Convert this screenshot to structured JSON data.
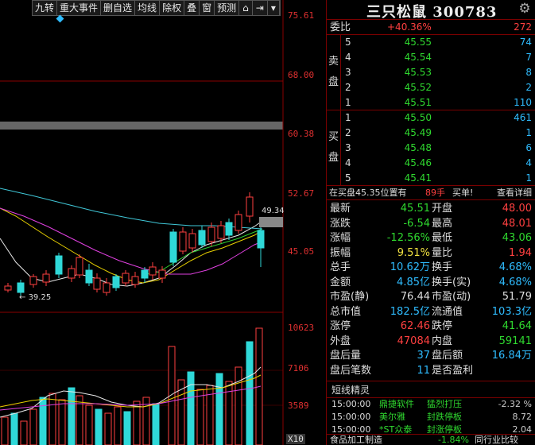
{
  "toolbar": {
    "items": [
      "九转",
      "重大事件",
      "删自选",
      "均线",
      "除权",
      "叠",
      "窗",
      "预测"
    ],
    "lock_icon": "lock-icon",
    "pin_icon": "pin-icon",
    "dropdown_icon": "triangle-down-icon"
  },
  "axis": {
    "price_labels": [
      "75.61",
      "68.00",
      "60.38",
      "52.67",
      "45.05"
    ],
    "volume_labels": [
      "10623",
      "7106",
      "3589"
    ],
    "volume_unit": "X10",
    "current_price_tag": "49.34",
    "low_marker": "39.25"
  },
  "stock": {
    "title": "三只松鼠 300783"
  },
  "weibi": {
    "label": "委比",
    "pct": "+40.36%",
    "diff": "272"
  },
  "sell": {
    "side_label": [
      "卖",
      "盘"
    ],
    "levels": [
      {
        "lvl": "5",
        "price": "45.55",
        "vol": "74"
      },
      {
        "lvl": "4",
        "price": "45.54",
        "vol": "7"
      },
      {
        "lvl": "3",
        "price": "45.53",
        "vol": "8"
      },
      {
        "lvl": "2",
        "price": "45.52",
        "vol": "2"
      },
      {
        "lvl": "1",
        "price": "45.51",
        "vol": "110"
      }
    ]
  },
  "buy": {
    "side_label": [
      "买",
      "盘"
    ],
    "levels": [
      {
        "lvl": "1",
        "price": "45.50",
        "vol": "461"
      },
      {
        "lvl": "2",
        "price": "45.49",
        "vol": "1"
      },
      {
        "lvl": "3",
        "price": "45.48",
        "vol": "6"
      },
      {
        "lvl": "4",
        "price": "45.46",
        "vol": "4"
      },
      {
        "lvl": "5",
        "price": "45.41",
        "vol": "1"
      }
    ]
  },
  "inline": {
    "text": "在买盘45.35位置有",
    "count": "89手",
    "action": "买单!",
    "detail": "查看详细"
  },
  "quote": [
    {
      "k1": "最新",
      "v1": "45.51",
      "c1": "green",
      "k2": "开盘",
      "v2": "48.00",
      "c2": "red"
    },
    {
      "k1": "涨跌",
      "v1": "-6.54",
      "c1": "green",
      "k2": "最高",
      "v2": "48.01",
      "c2": "red"
    },
    {
      "k1": "涨幅",
      "v1": "-12.56%",
      "c1": "green",
      "k2": "最低",
      "v2": "43.06",
      "c2": "green"
    },
    {
      "k1": "振幅",
      "v1": "9.51%",
      "c1": "yellow",
      "k2": "量比",
      "v2": "1.94",
      "c2": "red"
    },
    {
      "k1": "总手",
      "v1": "10.62万",
      "c1": "cyan",
      "k2": "换手",
      "v2": "4.68%",
      "c2": "cyan"
    },
    {
      "k1": "金额",
      "v1": "4.85亿",
      "c1": "cyan",
      "k2": "换手(实)",
      "v2": "4.68%",
      "c2": "cyan"
    },
    {
      "k1": "市盈(静)",
      "v1": "76.44",
      "c1": "white",
      "k2": "市盈(动)",
      "v2": "51.79",
      "c2": "white"
    },
    {
      "k1": "总市值",
      "v1": "182.5亿",
      "c1": "cyan",
      "k2": "流通值",
      "v2": "103.3亿",
      "c2": "cyan"
    },
    {
      "k1": "涨停",
      "v1": "62.46",
      "c1": "red",
      "k2": "跌停",
      "v2": "41.64",
      "c2": "green"
    },
    {
      "k1": "外盘",
      "v1": "47084",
      "c1": "red",
      "k2": "内盘",
      "v2": "59141",
      "c2": "green"
    },
    {
      "k1": "盘后量",
      "v1": "37",
      "c1": "cyan",
      "k2": "盘后额",
      "v2": "16.84万",
      "c2": "cyan"
    },
    {
      "k1": "盘后笔数",
      "v1": "11",
      "c1": "cyan",
      "k2": "是否盈利",
      "v2": "",
      "c2": "white"
    }
  ],
  "dx": {
    "title": "短线精灵",
    "items": [
      {
        "time": "15:00:00",
        "name": "鼎捷软件",
        "event": "猛烈打压",
        "pct": "-2.32 %"
      },
      {
        "time": "15:00:00",
        "name": "美尔雅",
        "event": "封跌停板",
        "pct": "8.72"
      },
      {
        "time": "15:00:00",
        "name": "*ST众泰",
        "event": "封涨停板",
        "pct": "2.04"
      }
    ]
  },
  "bottom": {
    "left": "食品加工制造",
    "mid": "-1.84%",
    "right": "同行业比较"
  },
  "colors": {
    "up": "#ff4040",
    "down": "#2fd82f",
    "volume": "#2fbcff",
    "panel_border": "#7a0000"
  }
}
